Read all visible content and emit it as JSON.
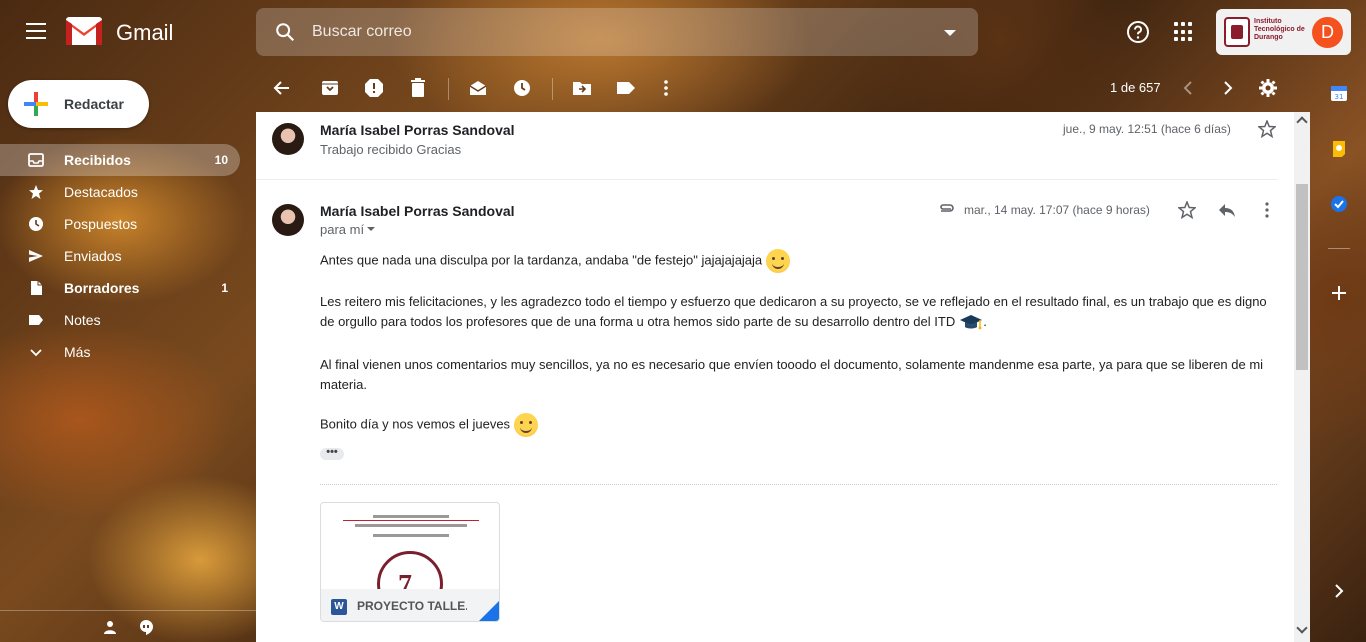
{
  "app": {
    "name": "Gmail"
  },
  "search": {
    "placeholder": "Buscar correo"
  },
  "account": {
    "org_name": "Instituto Tecnológico de Durango",
    "avatar_letter": "D",
    "avatar_color": "#f4511e"
  },
  "compose": {
    "label": "Redactar"
  },
  "sidebar": {
    "items": [
      {
        "label": "Recibidos",
        "count": "10",
        "icon": "inbox-icon",
        "active": true,
        "bold": true
      },
      {
        "label": "Destacados",
        "count": "",
        "icon": "star-icon",
        "active": false,
        "bold": false
      },
      {
        "label": "Pospuestos",
        "count": "",
        "icon": "clock-icon",
        "active": false,
        "bold": false
      },
      {
        "label": "Enviados",
        "count": "",
        "icon": "send-icon",
        "active": false,
        "bold": false
      },
      {
        "label": "Borradores",
        "count": "1",
        "icon": "draft-icon",
        "active": false,
        "bold": true
      },
      {
        "label": "Notes",
        "count": "",
        "icon": "label-icon",
        "active": false,
        "bold": false
      },
      {
        "label": "Más",
        "count": "",
        "icon": "chevron-down-icon",
        "active": false,
        "bold": false
      }
    ]
  },
  "toolbar": {
    "icons": [
      "back-arrow-icon",
      "archive-icon",
      "report-spam-icon",
      "delete-icon",
      "mark-unread-icon",
      "snooze-icon",
      "move-to-icon",
      "label-icon",
      "more-vert-icon",
      "prev-icon",
      "next-icon",
      "settings-icon"
    ],
    "pager": "1 de 657"
  },
  "thread": {
    "messages": [
      {
        "sender": "María Isabel Porras Sandoval",
        "snippet": "Trabajo recibido Gracias",
        "date": "jue., 9 may. 12:51 (hace 6 días)"
      },
      {
        "sender": "María Isabel Porras Sandoval",
        "to": "para mí",
        "date": "mar., 14 may. 17:07 (hace 9 horas)",
        "body": [
          "Antes que nada una disculpa por la tardanza, andaba \"de festejo\" jajajajajaja",
          "Les reitero mis felicitaciones, y les agradezco todo el tiempo y esfuerzo que dedicaron a su proyecto, se ve reflejado en el resultado final, es un trabajo que es digno de orgullo para todos los profesores que de una forma u otra hemos sido parte de su desarrollo dentro del ITD",
          "Al final vienen unos comentarios muy sencillos, ya no es necesario que envíen tooodo el documento, solamente mandenme esa parte, ya para que se liberen de mi materia.",
          "Bonito día y nos vemos el jueves"
        ],
        "ellipsis": "•••",
        "attachment": {
          "name": "PROYECTO TALLE...",
          "type": "word-doc-icon",
          "preview_number": "7"
        }
      }
    ]
  },
  "colors": {
    "accent_blue": "#1a73e8",
    "gmail_red": "#ea4335",
    "word_blue": "#2b579a"
  }
}
